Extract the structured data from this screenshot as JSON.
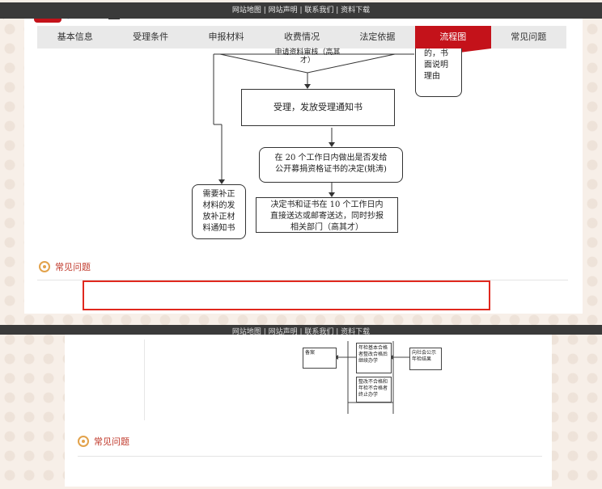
{
  "footer_links": "网站地图 | 网站声明 | 联系我们 | 资料下载",
  "tabs": [
    {
      "label": "基本信息"
    },
    {
      "label": "受理条件"
    },
    {
      "label": "申报材料"
    },
    {
      "label": "收费情况"
    },
    {
      "label": "法定依据"
    },
    {
      "label": "流程图",
      "active": true
    },
    {
      "label": "常见问题"
    }
  ],
  "flowchart": {
    "review_diamond": "申请资料审核（高其\n才）",
    "right_note": "的，书\n面说明\n理由",
    "accept": "受理，发放受理通知书",
    "decision": "在 20 个工作日内做出是否发给\n公开募捐资格证书的决定(姚涛)",
    "supplement": "需要补正\n材料的发\n放补正材\n料通知书",
    "deliver": "决定书和证书在 10 个工作日内\n直接送达或邮寄送达，同时抄报\n相关部门（高其才）"
  },
  "section_title": "常见问题",
  "lower": {
    "record": "备案",
    "pass": "年检基本合格者整改合格后继续办学",
    "publish": "向社会公示年检结果",
    "fail": "整改不合格和年检不合格者终止办学",
    "section_title": "常见问题"
  }
}
